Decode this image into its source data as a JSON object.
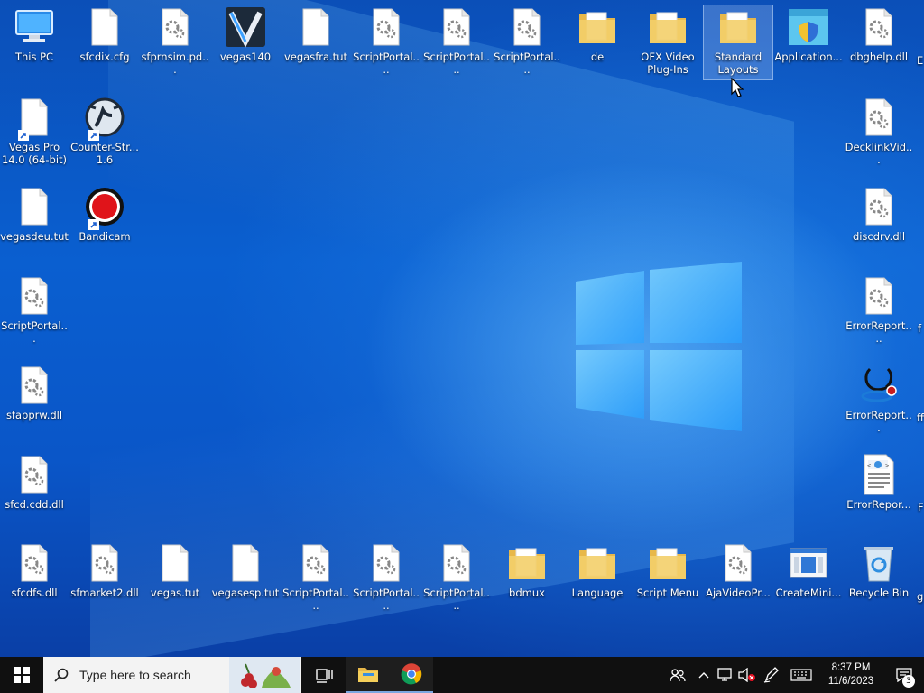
{
  "desktop": {
    "row1": [
      {
        "label": "This PC",
        "icon": "this-pc-icon"
      },
      {
        "label": "sfcdix.cfg",
        "icon": "file-icon"
      },
      {
        "label": "sfprnsim.pd...",
        "icon": "settings-file-icon"
      },
      {
        "label": "vegas140",
        "icon": "vegas-app-icon"
      },
      {
        "label": "vegasfra.tut",
        "icon": "file-icon"
      },
      {
        "label": "ScriptPortal....",
        "icon": "settings-file-icon"
      },
      {
        "label": "ScriptPortal....",
        "icon": "settings-file-icon"
      },
      {
        "label": "ScriptPortal....",
        "icon": "settings-file-icon"
      },
      {
        "label": "de",
        "icon": "folder-icon"
      },
      {
        "label": "OFX Video Plug-Ins",
        "icon": "folder-icon"
      },
      {
        "label": "Standard Layouts",
        "icon": "folder-icon"
      },
      {
        "label": "Application...",
        "icon": "application-shield-icon"
      },
      {
        "label": "dbghelp.dll",
        "icon": "settings-file-icon"
      }
    ],
    "col1": [
      {
        "label": "Vegas Pro 14.0 (64-bit)",
        "icon": "file-shortcut-icon"
      },
      {
        "label": "vegasdeu.tut",
        "icon": "file-icon"
      },
      {
        "label": "ScriptPortal...",
        "icon": "settings-file-icon"
      },
      {
        "label": "sfapprw.dll",
        "icon": "settings-file-icon"
      },
      {
        "label": "sfcd.cdd.dll",
        "icon": "settings-file-icon"
      }
    ],
    "col2": [
      {
        "label": "Counter-Str... 1.6",
        "icon": "counter-strike-icon"
      },
      {
        "label": "Bandicam",
        "icon": "bandicam-icon"
      }
    ],
    "rightcol": [
      {
        "label": "DecklinkVid...",
        "icon": "settings-file-icon"
      },
      {
        "label": "discdrv.dll",
        "icon": "settings-file-icon"
      },
      {
        "label": "ErrorReport....",
        "icon": "settings-file-icon"
      },
      {
        "label": "ErrorReport...",
        "icon": "error-report-icon"
      },
      {
        "label": "ErrorRepor...",
        "icon": "web-document-icon"
      }
    ],
    "bottomrow": [
      {
        "label": "sfcdfs.dll",
        "icon": "settings-file-icon"
      },
      {
        "label": "sfmarket2.dll",
        "icon": "settings-file-icon"
      },
      {
        "label": "vegas.tut",
        "icon": "file-icon"
      },
      {
        "label": "vegasesp.tut",
        "icon": "file-icon"
      },
      {
        "label": "ScriptPortal....",
        "icon": "settings-file-icon"
      },
      {
        "label": "ScriptPortal....",
        "icon": "settings-file-icon"
      },
      {
        "label": "ScriptPortal....",
        "icon": "settings-file-icon"
      },
      {
        "label": "bdmux",
        "icon": "folder-icon"
      },
      {
        "label": "Language",
        "icon": "folder-icon"
      },
      {
        "label": "Script Menu",
        "icon": "folder-icon"
      },
      {
        "label": "AjaVideoPr...",
        "icon": "settings-file-icon"
      },
      {
        "label": "CreateMini...",
        "icon": "app-window-icon"
      },
      {
        "label": "Recycle Bin",
        "icon": "recycle-bin-icon"
      }
    ],
    "edge_labels": [
      "E",
      "f",
      "ff",
      "F",
      "g"
    ]
  },
  "taskbar": {
    "search_placeholder": "Type here to search",
    "time": "8:37 PM",
    "date": "11/6/2023",
    "notification_count": "3"
  },
  "colors": {
    "desktop_blue": "#0a5fd0",
    "taskbar": "#101010",
    "folder_yellow": "#f3cf6a"
  }
}
